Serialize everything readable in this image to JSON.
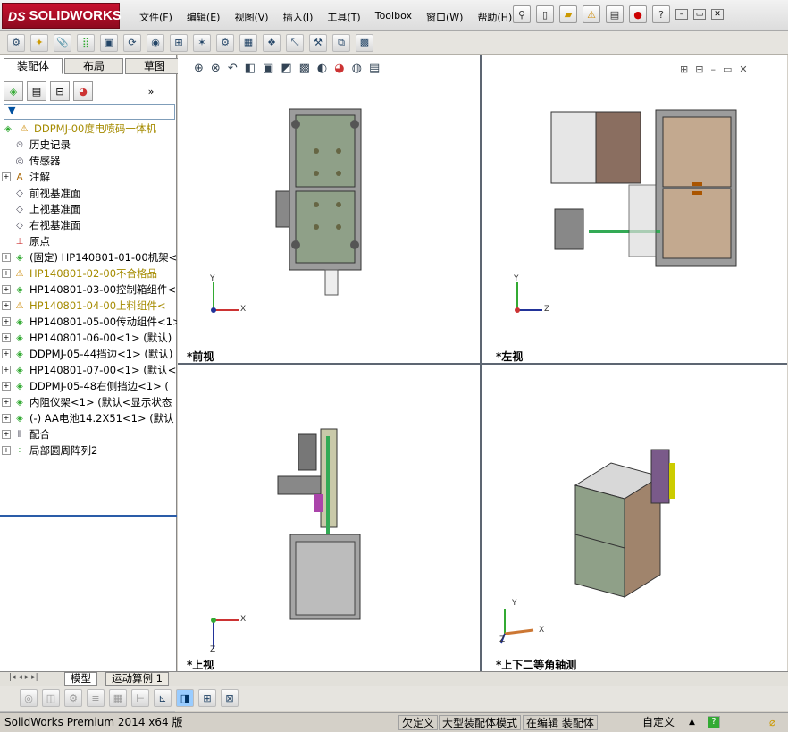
{
  "app": {
    "logo": "SOLIDWORKS",
    "logo_prefix": "DS"
  },
  "menu": [
    "文件(F)",
    "编辑(E)",
    "视图(V)",
    "插入(I)",
    "工具(T)",
    "Toolbox",
    "窗口(W)",
    "帮助(H)"
  ],
  "left_tabs": [
    "装配体",
    "布局",
    "草图"
  ],
  "tree": {
    "root": "DDPMJ-00度电喷码一体机",
    "items": [
      {
        "label": "历史记录",
        "icon": "history-icon",
        "expand": false,
        "warn": false
      },
      {
        "label": "传感器",
        "icon": "sensor-icon",
        "expand": false,
        "warn": false
      },
      {
        "label": "注解",
        "icon": "annotation-icon",
        "expand": true,
        "warn": false
      },
      {
        "label": "前视基准面",
        "icon": "plane-icon",
        "expand": false,
        "warn": false
      },
      {
        "label": "上视基准面",
        "icon": "plane-icon",
        "expand": false,
        "warn": false
      },
      {
        "label": "右视基准面",
        "icon": "plane-icon",
        "expand": false,
        "warn": false
      },
      {
        "label": "原点",
        "icon": "origin-icon",
        "expand": false,
        "warn": false
      },
      {
        "label": "(固定) HP140801-01-00机架<",
        "icon": "assembly-icon",
        "expand": true,
        "warn": false
      },
      {
        "label": "HP140801-02-00不合格品",
        "icon": "warning-assembly-icon",
        "expand": true,
        "warn": true
      },
      {
        "label": "HP140801-03-00控制箱组件<",
        "icon": "assembly-icon",
        "expand": true,
        "warn": false
      },
      {
        "label": "HP140801-04-00上料组件<",
        "icon": "warning-assembly-icon",
        "expand": true,
        "warn": true
      },
      {
        "label": "HP140801-05-00传动组件<1>",
        "icon": "assembly-icon",
        "expand": true,
        "warn": false
      },
      {
        "label": "HP140801-06-00<1> (默认)",
        "icon": "assembly-icon",
        "expand": true,
        "warn": false
      },
      {
        "label": "DDPMJ-05-44挡边<1> (默认)",
        "icon": "assembly-icon",
        "expand": true,
        "warn": false
      },
      {
        "label": "HP140801-07-00<1> (默认<",
        "icon": "assembly-icon",
        "expand": true,
        "warn": false
      },
      {
        "label": "DDPMJ-05-48右侧挡边<1> (",
        "icon": "assembly-icon",
        "expand": true,
        "warn": false
      },
      {
        "label": "内阻仪架<1> (默认<显示状态",
        "icon": "assembly-icon",
        "expand": true,
        "warn": false
      },
      {
        "label": "(-) AA电池14.2X51<1> (默认",
        "icon": "assembly-icon",
        "expand": true,
        "warn": false
      },
      {
        "label": "配合",
        "icon": "mate-icon",
        "expand": true,
        "warn": false
      },
      {
        "label": "局部圆周阵列2",
        "icon": "pattern-icon",
        "expand": true,
        "warn": false
      }
    ]
  },
  "viewports": {
    "front": "*前视",
    "left": "*左视",
    "top": "*上视",
    "iso": "*上下二等角轴测"
  },
  "axes": {
    "x": "X",
    "y": "Y",
    "z": "Z"
  },
  "bottom_tabs": [
    "模型",
    "运动算例 1"
  ],
  "status": {
    "product": "SolidWorks Premium 2014 x64 版",
    "defined": "欠定义",
    "mode": "大型装配体模式",
    "editing": "在编辑 装配体",
    "custom": "自定义"
  }
}
